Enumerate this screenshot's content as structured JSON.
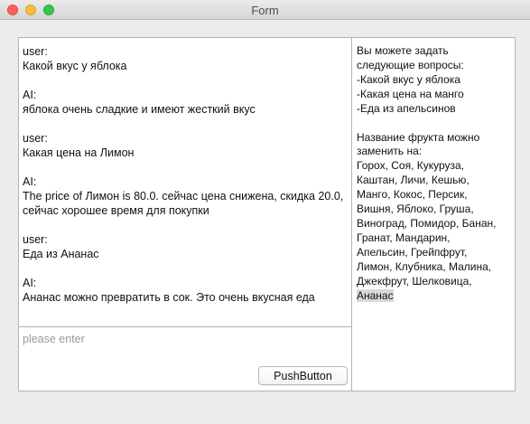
{
  "window": {
    "title": "Form"
  },
  "chat": {
    "messages": [
      {
        "role": "user:",
        "text": "Какой вкус у яблока"
      },
      {
        "role": "AI:",
        "text": "яблока  очень сладкие и имеют жесткий вкус"
      },
      {
        "role": "user:",
        "text": "Какая цена на Лимон"
      },
      {
        "role": "AI:",
        "text": "The price of Лимон is 80.0. сейчас цена снижена, скидка 20.0, сейчас хорошее время для покупки"
      },
      {
        "role": "user:",
        "text": "Еда из Ананас"
      },
      {
        "role": "AI:",
        "text": "Ананас можно превратить в сок. Это очень вкусная еда"
      }
    ]
  },
  "input": {
    "value": "",
    "placeholder": "please enter"
  },
  "button": {
    "label": "PushButton"
  },
  "side": {
    "intro": [
      "Вы можете задать",
      "следующие вопросы:",
      "-Какой вкус у яблока",
      "-Какая цена на манго",
      "-Еда из апельсинов"
    ],
    "replace_title": [
      "Название фрукта можно",
      "заменить на:"
    ],
    "fruit_lines": [
      "Горох, Соя, Кукуруза,",
      "Каштан, Личи, Кешью,",
      "Манго, Кокос, Персик,",
      "Вишня, Яблоко, Груша,",
      "Виноград, Помидор, Банан,",
      "Гранат, Мандарин,",
      "Апельсин, Грейпфрут,",
      "Лимон, Клубника, Малина,",
      "Джекфрут, Шелковица,"
    ],
    "last_fruit": "Ананас"
  }
}
